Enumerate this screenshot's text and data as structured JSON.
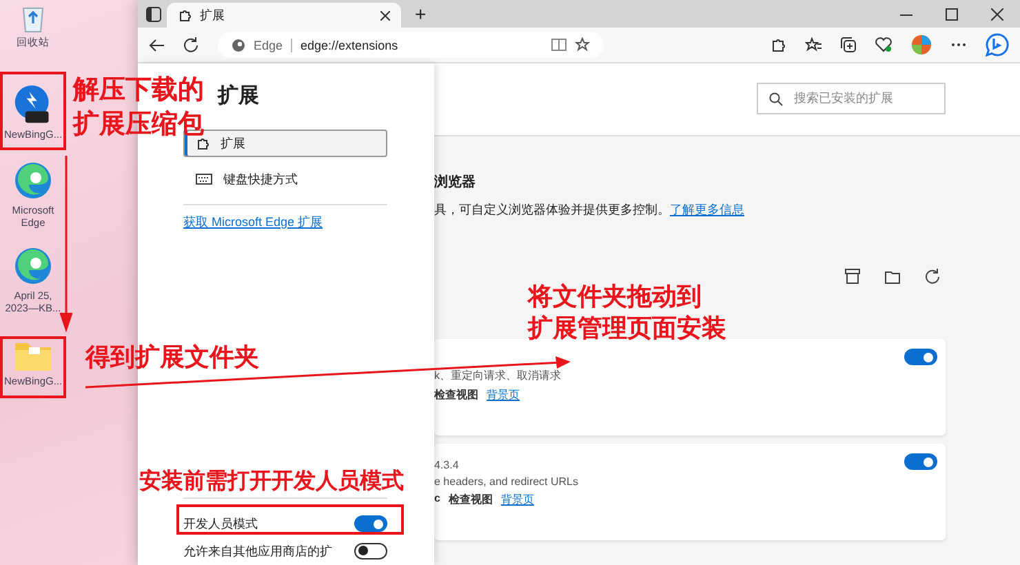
{
  "desktop": {
    "icons": [
      {
        "kind": "recycle",
        "label": "回收站"
      },
      {
        "kind": "zip",
        "label": "NewBingG..."
      },
      {
        "kind": "edge",
        "label": "Microsoft Edge"
      },
      {
        "kind": "edge",
        "label": "April 25, 2023—KB..."
      },
      {
        "kind": "folder",
        "label": "NewBingG..."
      }
    ]
  },
  "browser": {
    "tabs": [
      {
        "label": "扩展",
        "selected": true
      }
    ],
    "new_tab": "+",
    "address": {
      "site": "Edge",
      "url": "edge://extensions"
    },
    "sidebar": {
      "title": "扩展",
      "items": [
        {
          "label": "扩展",
          "selected": true,
          "kind": "puzzle"
        },
        {
          "label": "键盘快捷方式",
          "selected": false,
          "kind": "keyboard"
        }
      ],
      "store_link": "获取 Microsoft Edge 扩展",
      "settings": [
        {
          "label": "开发人员模式",
          "on": true
        },
        {
          "label": "允许来自其他应用商店的扩",
          "on": false
        }
      ]
    },
    "search": {
      "placeholder": "搜索已安装的扩展"
    },
    "heading": "浏览器",
    "description": "具，可自定义浏览器体验并提供更多控制。",
    "learn_more": "了解更多信息",
    "cards": [
      {
        "description": "k、重定向请求、取消请求",
        "links": [
          "检查视图",
          "背景页"
        ],
        "on": true
      },
      {
        "version": "4.3.4",
        "description": "e headers, and redirect URLs",
        "details": "c",
        "links": [
          "检查视图",
          "背景页"
        ],
        "on": true
      }
    ]
  },
  "annotations": [
    {
      "lines": [
        "解压下载的",
        "扩展压缩包"
      ]
    },
    {
      "lines": [
        "得到扩展文件夹"
      ]
    },
    {
      "lines": [
        "将文件夹拖动到",
        "扩展管理页面安装"
      ]
    },
    {
      "lines": [
        "安装前需打开开发人员模式"
      ]
    }
  ]
}
